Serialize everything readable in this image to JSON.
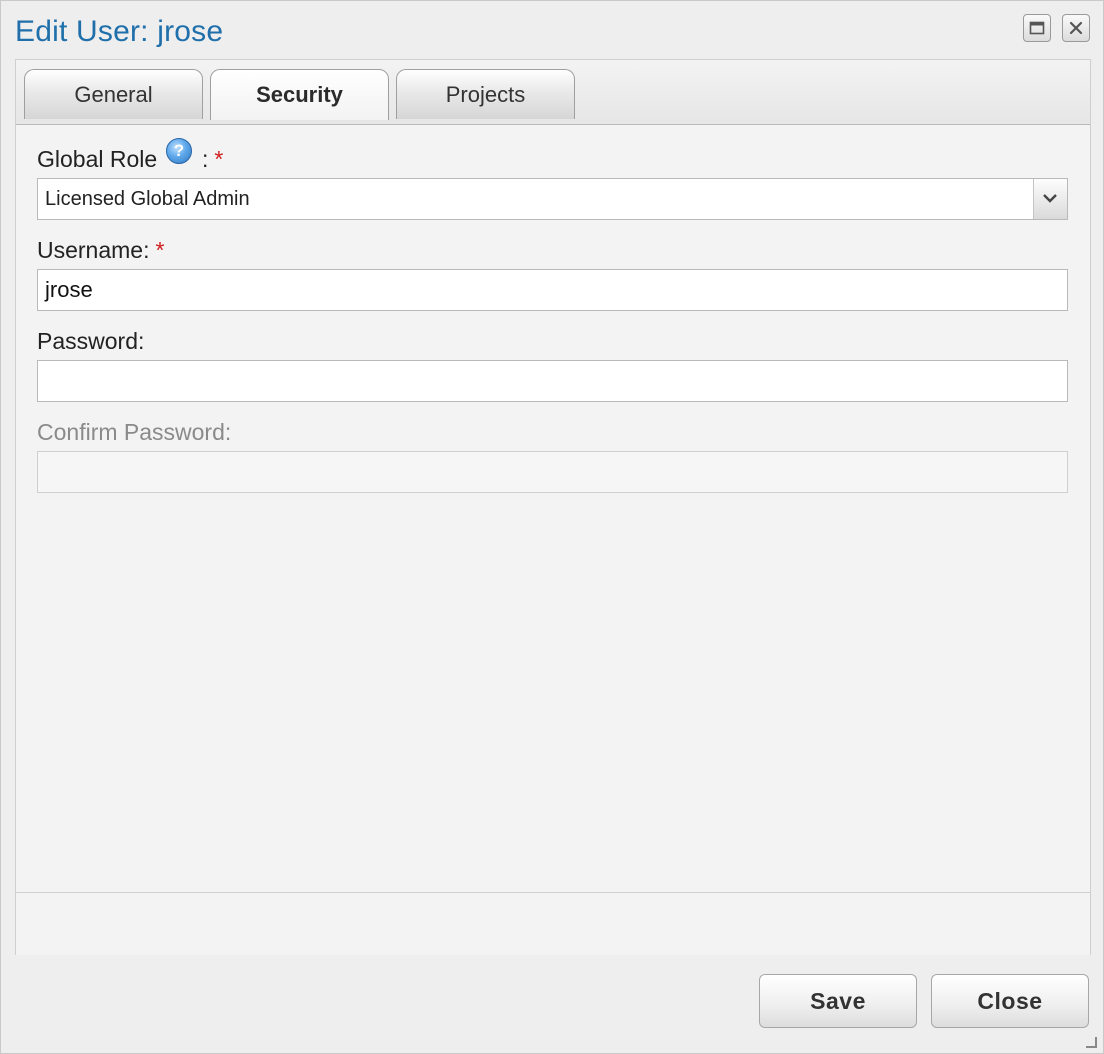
{
  "dialog": {
    "title": "Edit User: jrose"
  },
  "tabs": [
    {
      "label": "General",
      "active": false
    },
    {
      "label": "Security",
      "active": true
    },
    {
      "label": "Projects",
      "active": false
    }
  ],
  "form": {
    "global_role": {
      "label": "Global Role",
      "separator": ":",
      "required_mark": "*",
      "value": "Licensed Global Admin"
    },
    "username": {
      "label": "Username:",
      "required_mark": "*",
      "value": "jrose"
    },
    "password": {
      "label": "Password:",
      "value": ""
    },
    "confirm_password": {
      "label": "Confirm Password:",
      "value": "",
      "disabled": true
    }
  },
  "buttons": {
    "save": "Save",
    "close": "Close"
  },
  "icons": {
    "help": "help-icon",
    "maximize": "maximize-icon",
    "close": "close-icon",
    "dropdown": "chevron-down-icon",
    "resize": "resize-grip-icon"
  },
  "colors": {
    "title": "#1f6fab",
    "required": "#d21c1c",
    "help_icon": "#2f77c2"
  }
}
